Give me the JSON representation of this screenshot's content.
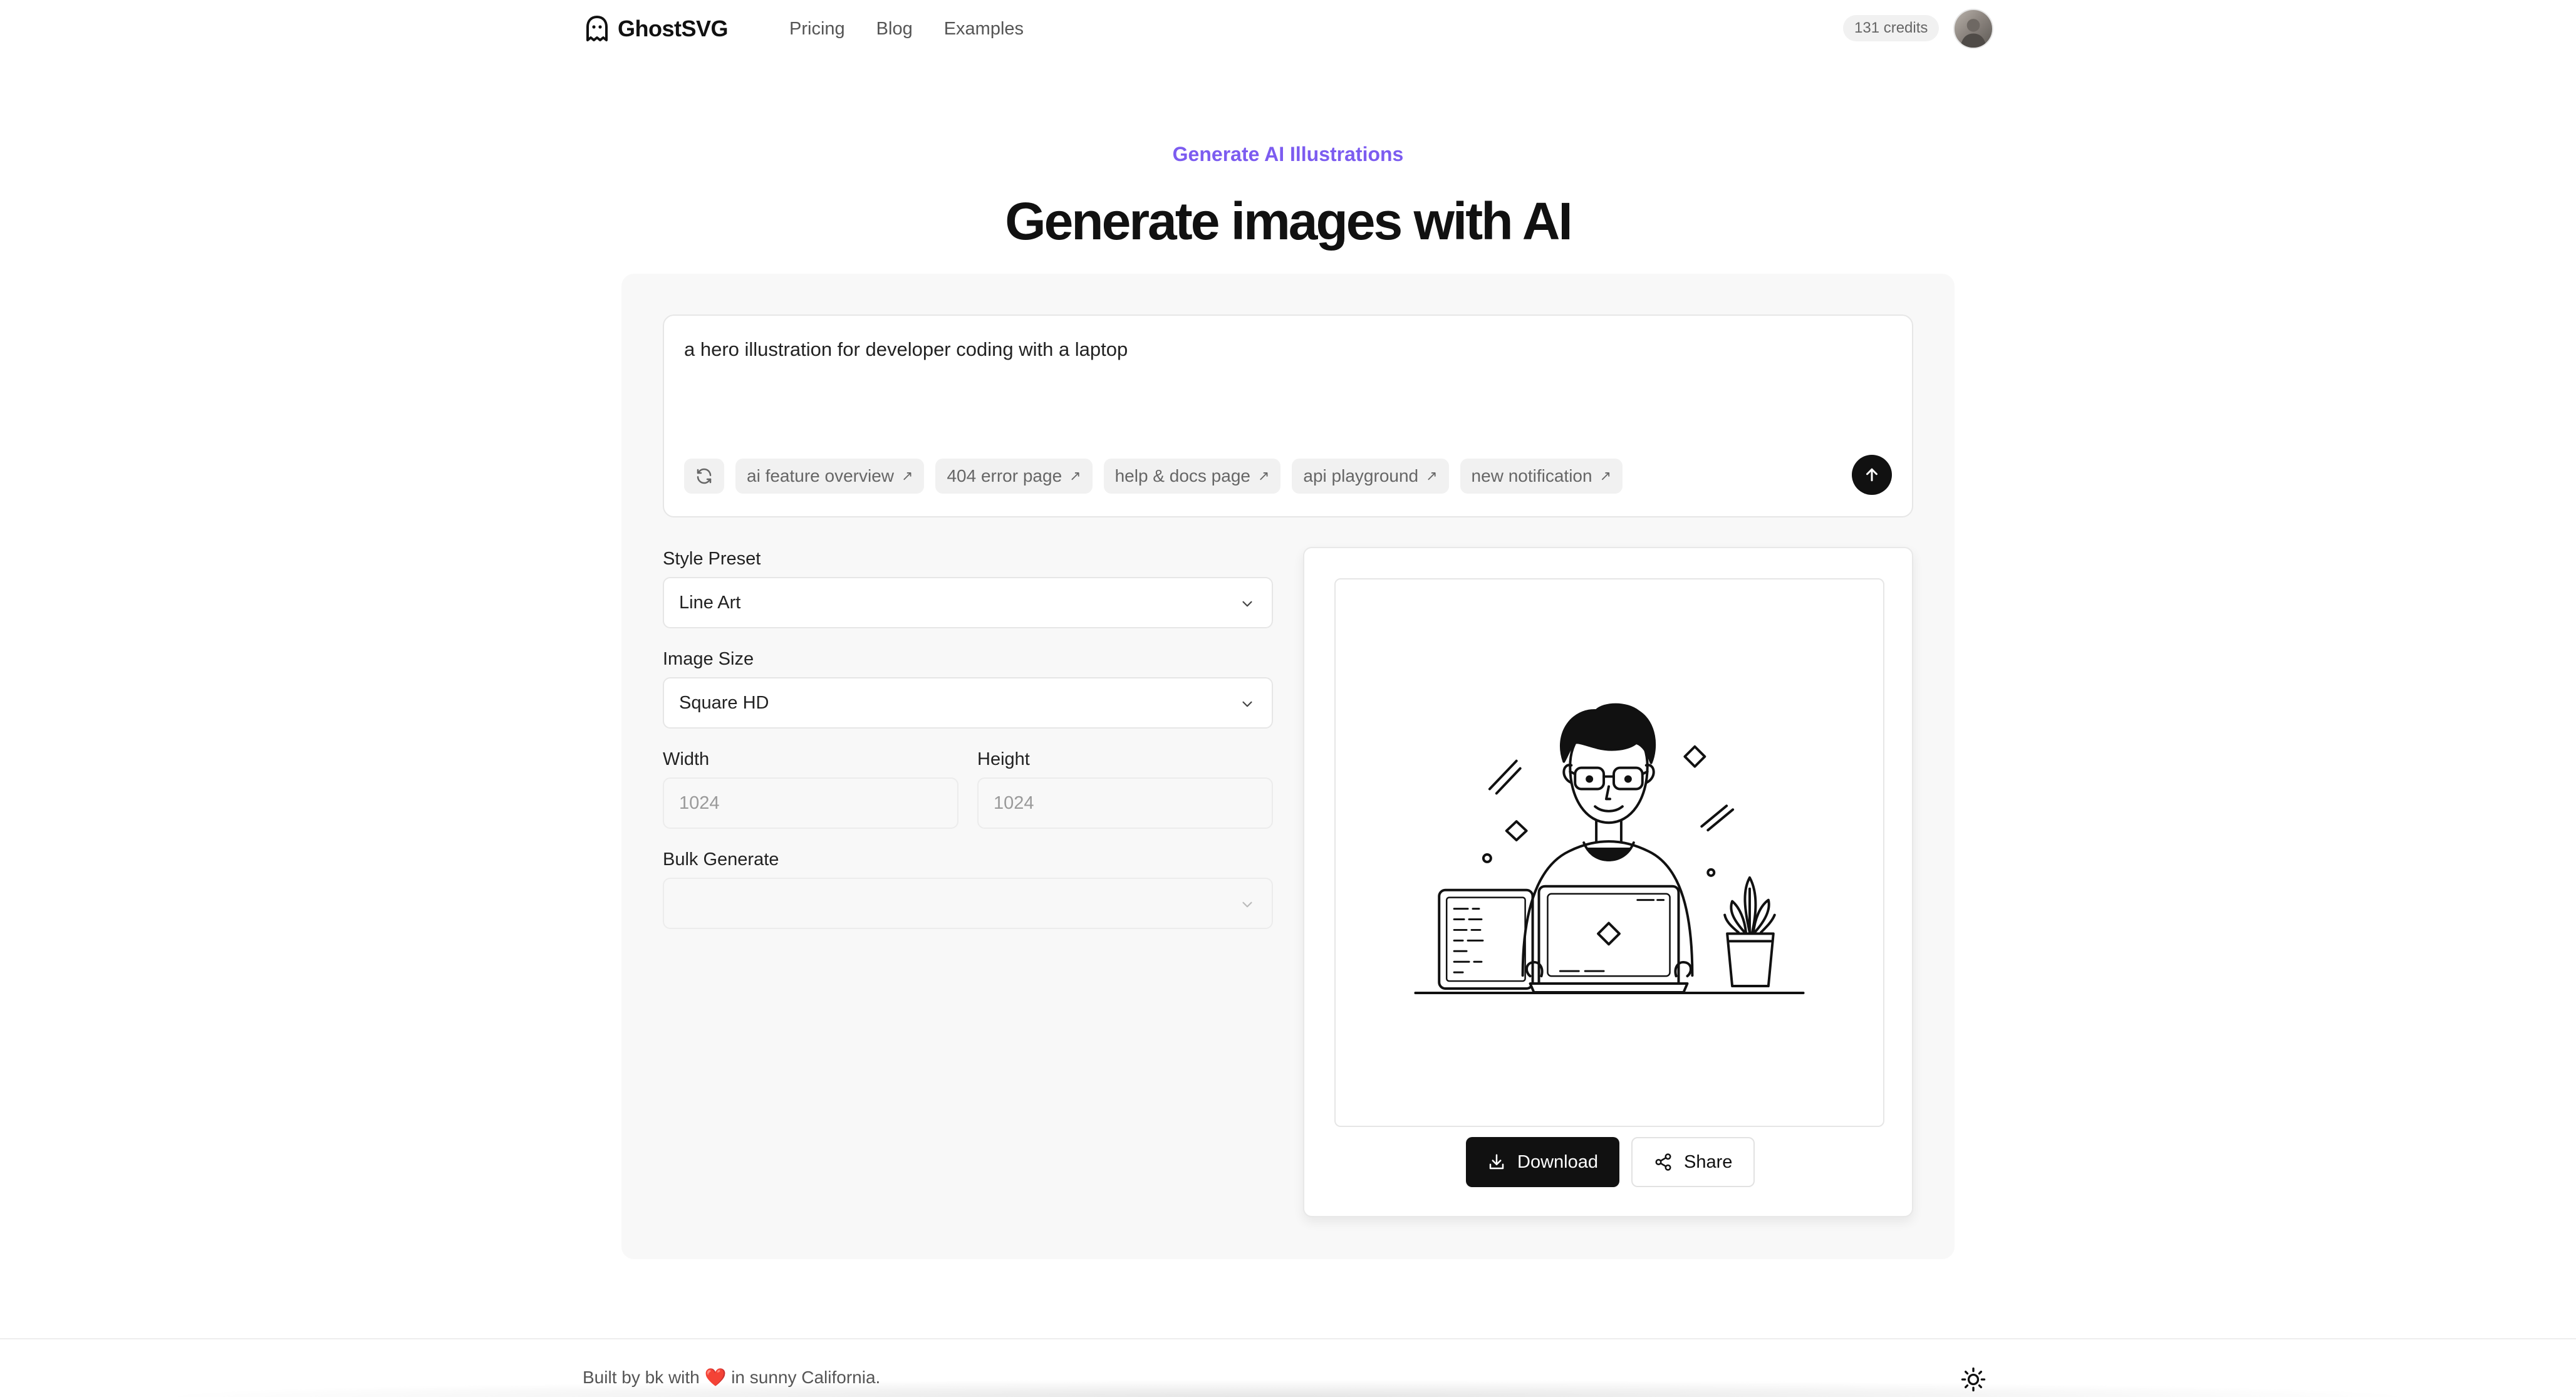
{
  "header": {
    "logo_text": "GhostSVG",
    "nav": [
      {
        "label": "Pricing"
      },
      {
        "label": "Blog"
      },
      {
        "label": "Examples"
      }
    ],
    "credits": "131 credits"
  },
  "hero": {
    "eyebrow": "Generate AI Illustrations",
    "title": "Generate images with AI"
  },
  "prompt": {
    "text": "a hero illustration for developer coding with a laptop",
    "suggestions": [
      {
        "label": "ai feature overview"
      },
      {
        "label": "404 error page"
      },
      {
        "label": "help & docs page"
      },
      {
        "label": "api playground"
      },
      {
        "label": "new notification"
      }
    ]
  },
  "form": {
    "style_preset": {
      "label": "Style Preset",
      "value": "Line Art"
    },
    "image_size": {
      "label": "Image Size",
      "value": "Square HD"
    },
    "width": {
      "label": "Width",
      "placeholder": "1024"
    },
    "height": {
      "label": "Height",
      "placeholder": "1024"
    },
    "bulk_generate": {
      "label": "Bulk Generate",
      "value": ""
    }
  },
  "preview": {
    "download_label": "Download",
    "share_label": "Share"
  },
  "footer": {
    "text_before": "Built by bk with",
    "heart": "❤️",
    "text_after": "in sunny California."
  },
  "colors": {
    "accent": "#7c5cf0",
    "primary_button": "#111111",
    "panel_bg": "#f8f8f8"
  }
}
